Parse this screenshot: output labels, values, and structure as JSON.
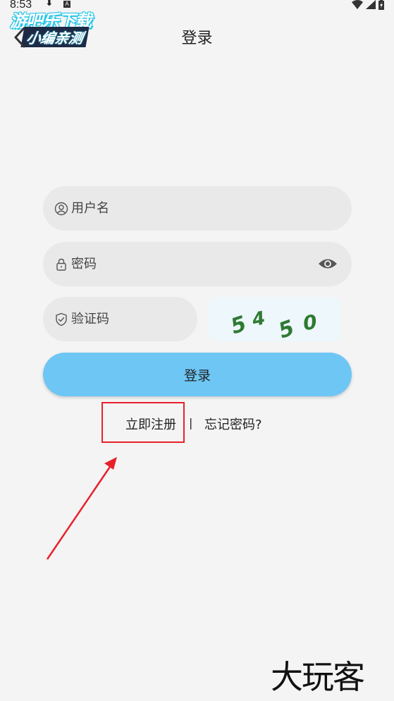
{
  "status_bar": {
    "time": "8:53",
    "download_glyph": "⬇",
    "a_badge": "A"
  },
  "watermark_top": {
    "line1": "游吧乐下载",
    "line2": "小编亲测"
  },
  "header": {
    "title": "登录"
  },
  "form": {
    "username_placeholder": "用户名",
    "password_placeholder": "密码",
    "captcha_placeholder": "验证码",
    "captcha_chars": [
      "5",
      "4",
      "5",
      "0"
    ],
    "login_label": "登录"
  },
  "links": {
    "register": "立即注册",
    "separator": "|",
    "forgot": "忘记密码?"
  },
  "watermark_bottom": {
    "text": "大玩客"
  },
  "colors": {
    "background": "#f4f4f4",
    "field_bg": "#e9e9e9",
    "primary_button": "#6ec6f5",
    "captcha_text": "#2e7a32",
    "highlight_red": "#e8202a"
  }
}
